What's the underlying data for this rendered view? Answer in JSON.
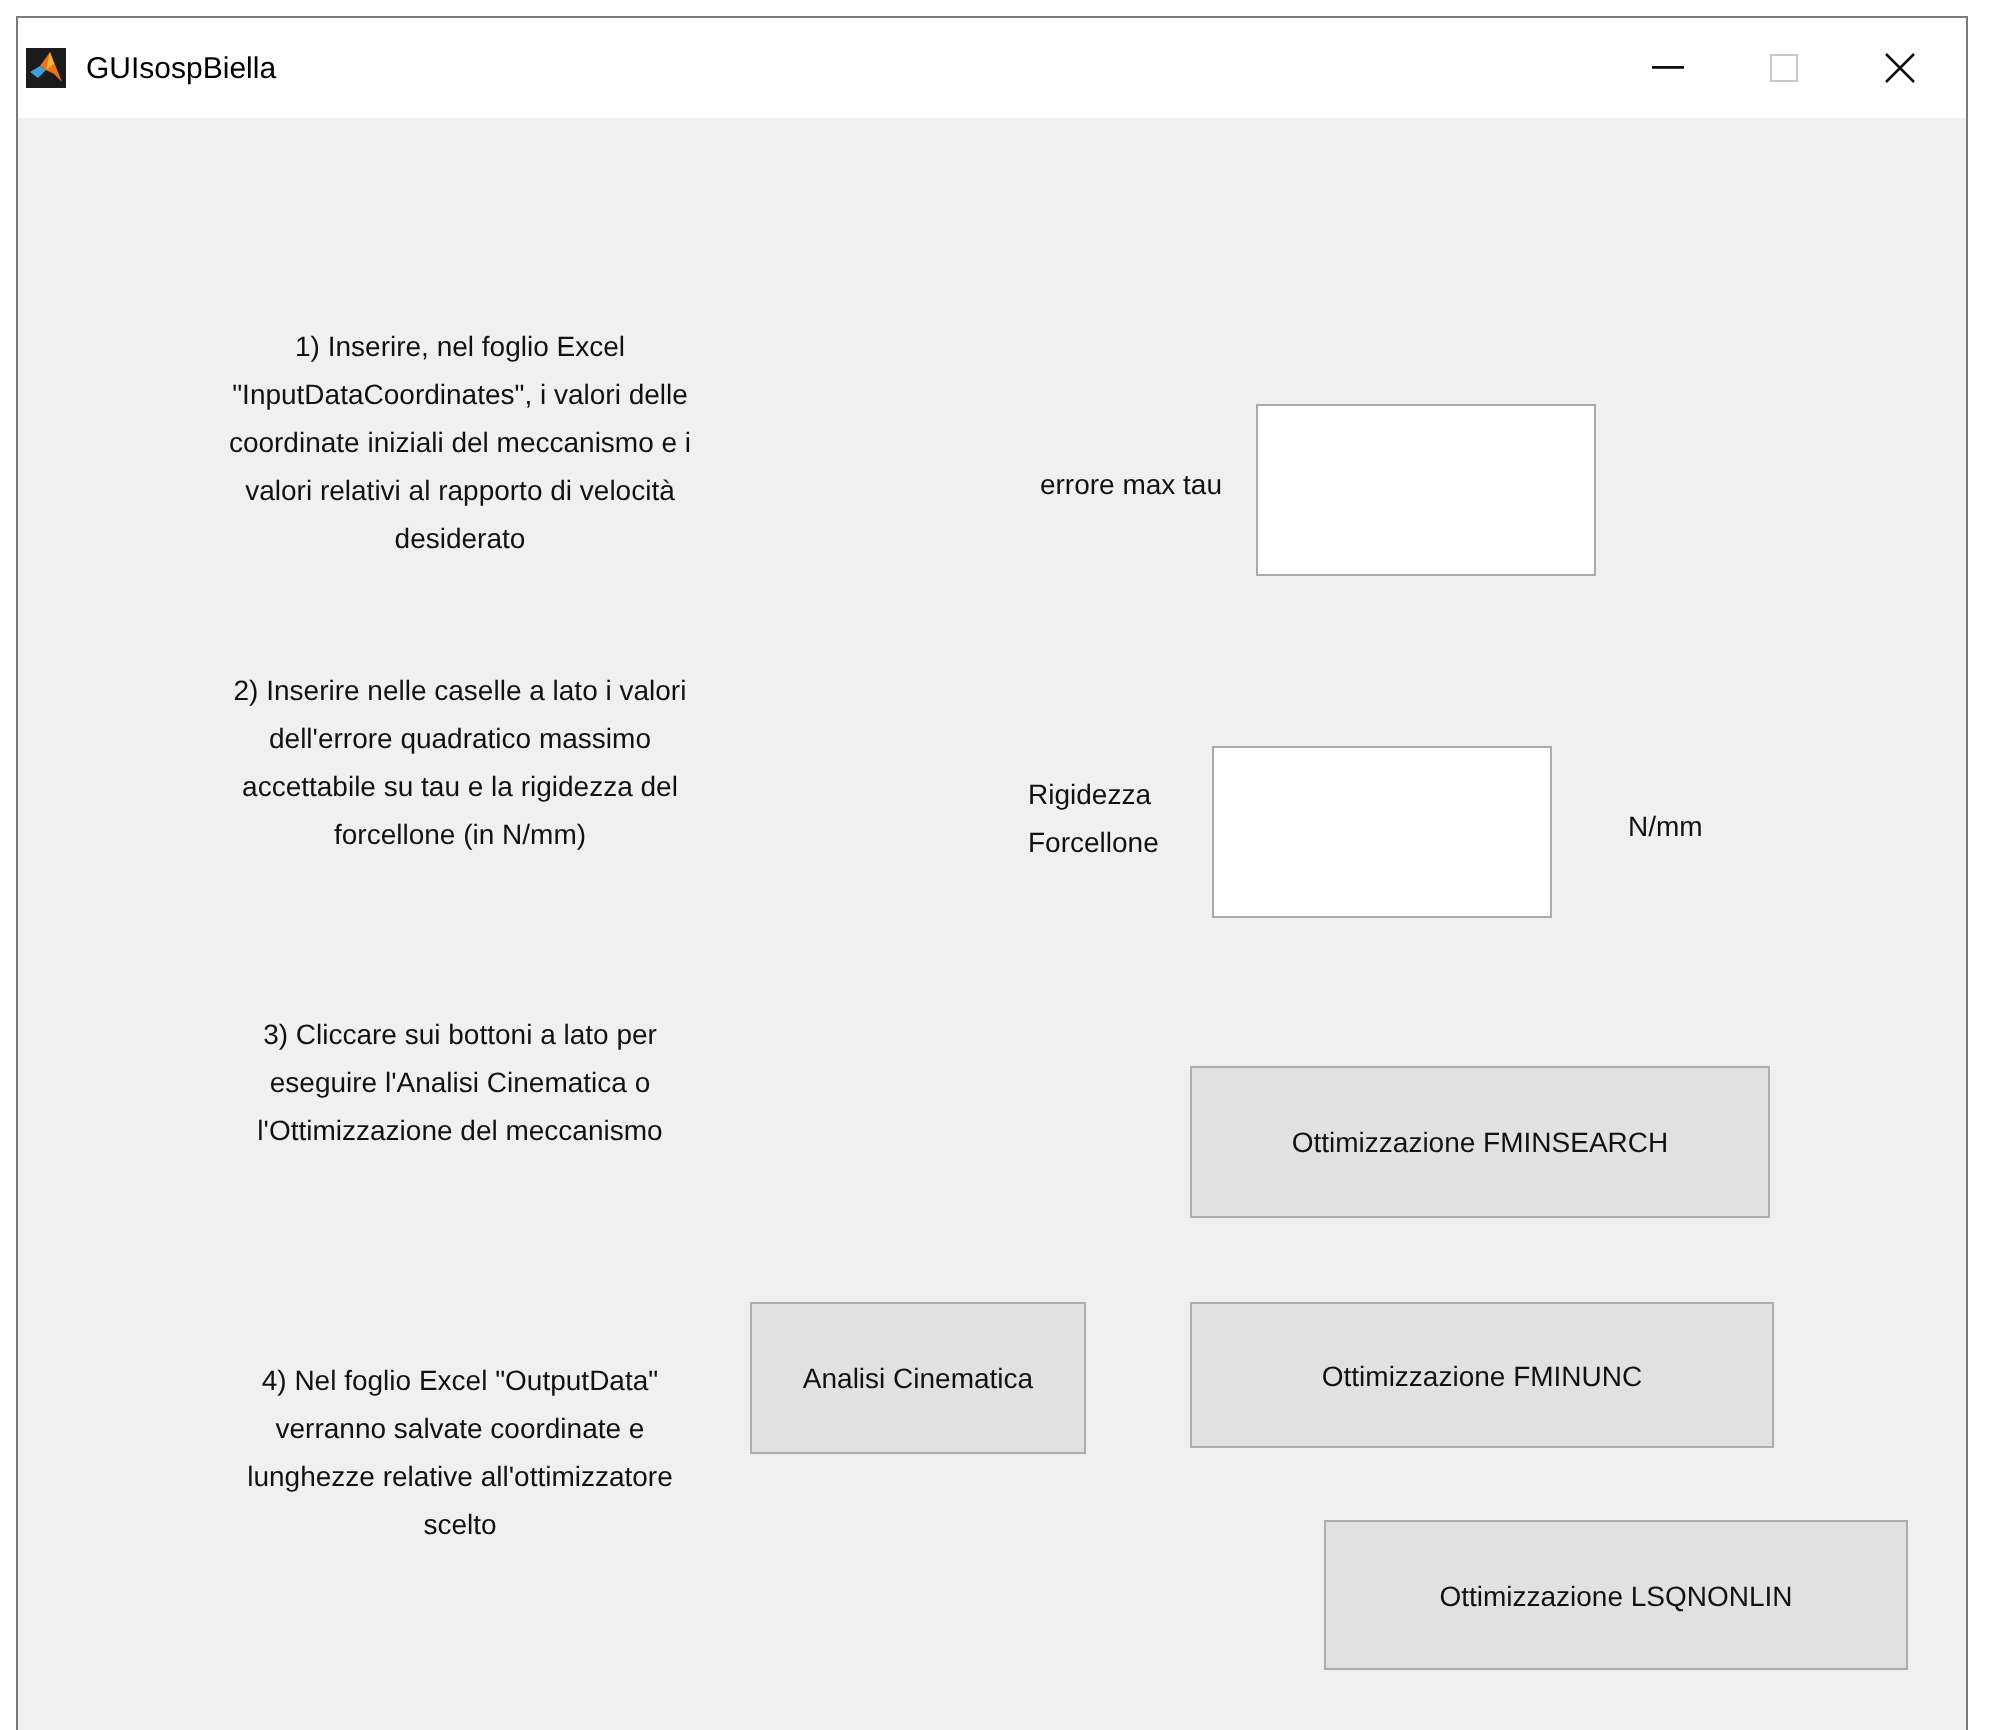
{
  "window": {
    "title": "GUIsospBiella"
  },
  "instructions": [
    "1) Inserire, nel foglio Excel \"InputDataCoordinates\", i valori delle coordinate iniziali del meccanismo e i valori relativi al rapporto di velocità desiderato",
    "2) Inserire nelle caselle a lato i valori dell'errore quadratico massimo accettabile su tau e la rigidezza del forcellone (in N/mm)",
    "3) Cliccare sui bottoni a lato per eseguire l'Analisi Cinematica o l'Ottimizzazione del meccanismo",
    "4) Nel foglio Excel \"OutputData\" verranno salvate coordinate e lunghezze relative all'ottimizzatore scelto"
  ],
  "inputs": [
    {
      "label": "errore max tau"
    },
    {
      "label": "Rigidezza Forcellone",
      "unit": "N/mm"
    }
  ],
  "buttons": [
    {
      "label": "Ottimizzazione FMINSEARCH"
    },
    {
      "label": "Analisi Cinematica"
    },
    {
      "label": "Ottimizzazione FMINUNC"
    },
    {
      "label": "Ottimizzazione LSQNONLIN"
    }
  ]
}
